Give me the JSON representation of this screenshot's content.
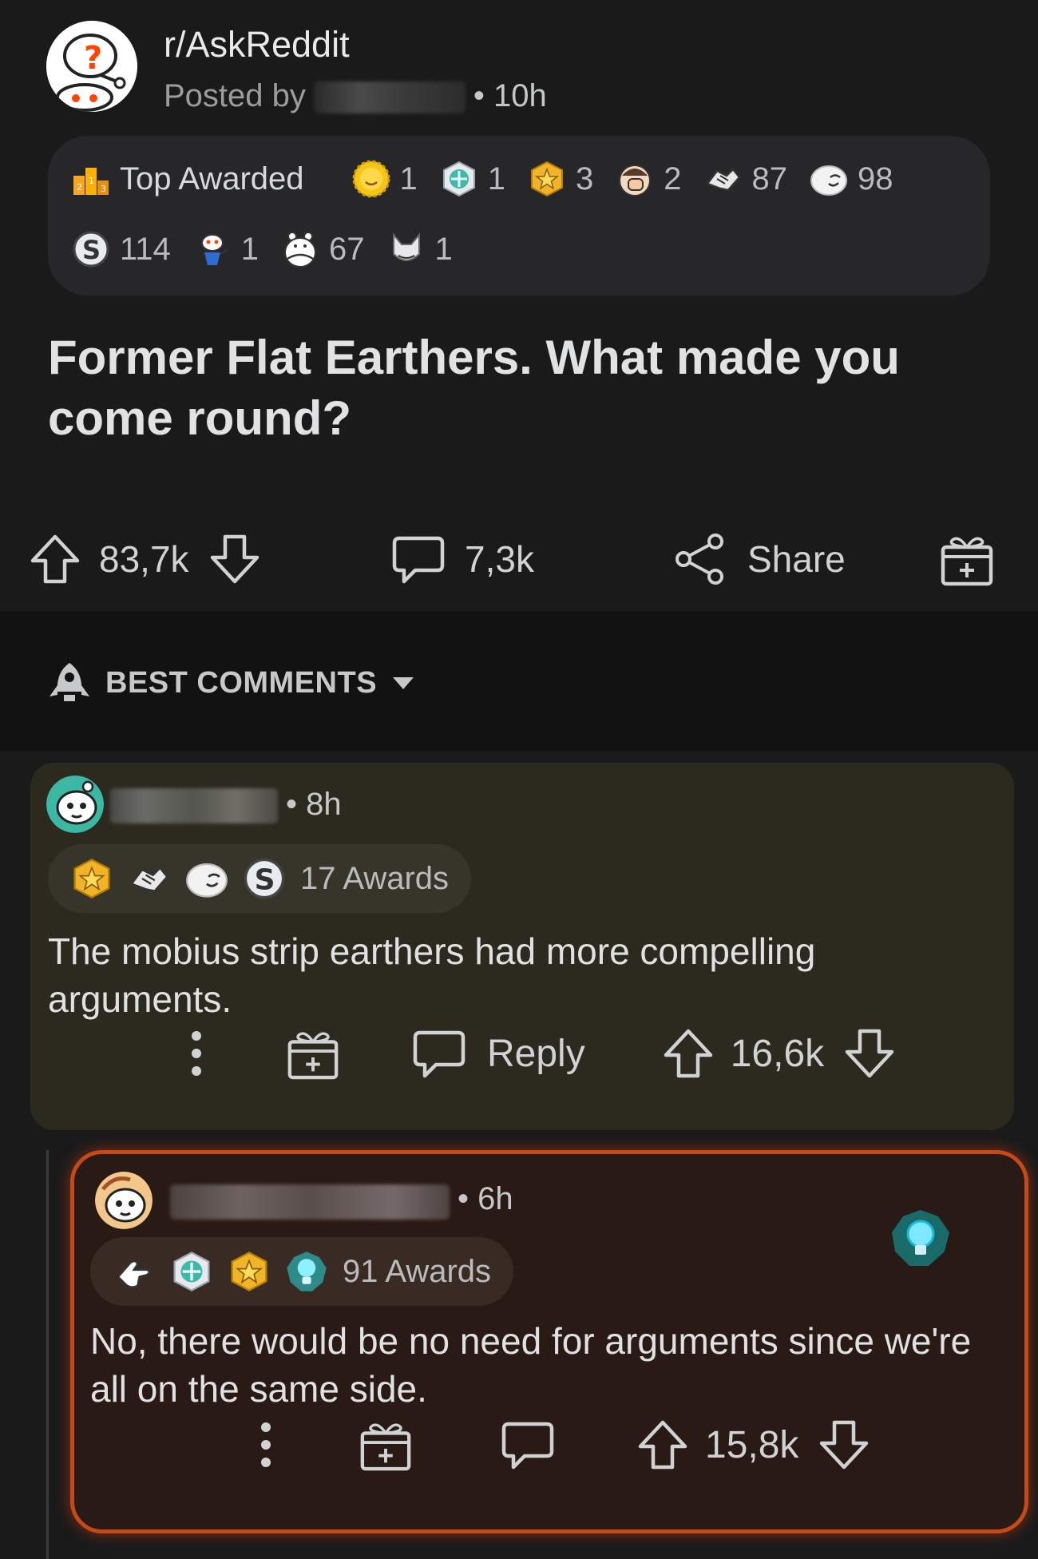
{
  "post": {
    "subreddit": "r/AskReddit",
    "posted_by_label": "Posted by",
    "posted_time": "• 10h",
    "top_awarded_label": "Top Awarded",
    "awards_row1": [
      {
        "icon": "gold-sun-award-icon",
        "count": "1"
      },
      {
        "icon": "platinum-shield-award-icon",
        "count": "1"
      },
      {
        "icon": "gold-star-award-icon",
        "count": "3"
      },
      {
        "icon": "facepalm-award-icon",
        "count": "2"
      },
      {
        "icon": "handshake-award-icon",
        "count": "87"
      },
      {
        "icon": "laughing-face-award-icon",
        "count": "98"
      }
    ],
    "awards_row2": [
      {
        "icon": "silver-coin-award-icon",
        "count": "114"
      },
      {
        "icon": "snoo-dance-award-icon",
        "count": "1"
      },
      {
        "icon": "polar-bear-hug-award-icon",
        "count": "67"
      },
      {
        "icon": "fox-award-icon",
        "count": "1"
      }
    ],
    "title": "Former Flat Earthers. What made you come round?",
    "upvotes": "83,7k",
    "comments": "7,3k",
    "share_label": "Share"
  },
  "sort": {
    "label": "BEST COMMENTS"
  },
  "comments": [
    {
      "time": "• 8h",
      "awards_label": "17 Awards",
      "award_icons": [
        "gold-star-award-icon",
        "handshake-award-icon",
        "laughing-face-award-icon",
        "silver-coin-award-icon"
      ],
      "body": "The mobius strip earthers had more compelling arguments.",
      "reply_label": "Reply",
      "votes": "16,6k"
    },
    {
      "time": "• 6h",
      "awards_label": "91 Awards",
      "award_icons": [
        "pointing-hand-award-icon",
        "platinum-shield-award-icon",
        "gold-star-award-icon",
        "lightbulb-award-icon"
      ],
      "body": "No, there would be no need for arguments since we're all on the same side.",
      "votes": "15,8k"
    }
  ],
  "colors": {
    "background": "#1a1a1b",
    "comment1_bg": "#2c2a1f",
    "comment2_bg": "#291a15",
    "comment2_border": "#c44a1a"
  }
}
